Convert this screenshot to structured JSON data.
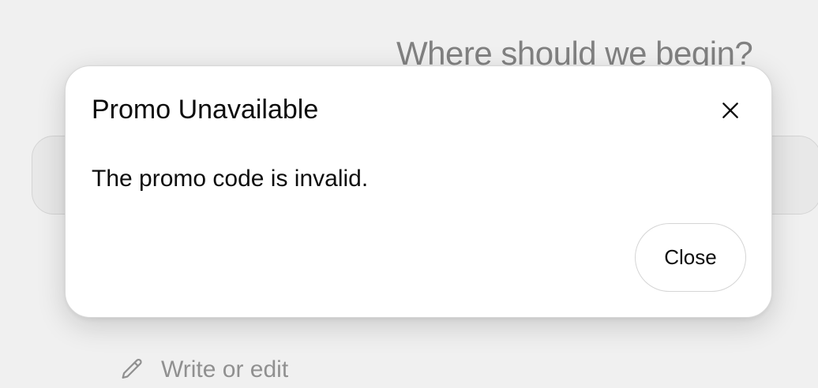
{
  "background": {
    "heading": "Where should we begin?",
    "suggestion": {
      "icon": "pencil-icon",
      "label": "Write or edit"
    }
  },
  "dialog": {
    "title": "Promo Unavailable",
    "message": "The promo code is invalid.",
    "close_icon": "close-icon",
    "close_button_label": "Close"
  }
}
